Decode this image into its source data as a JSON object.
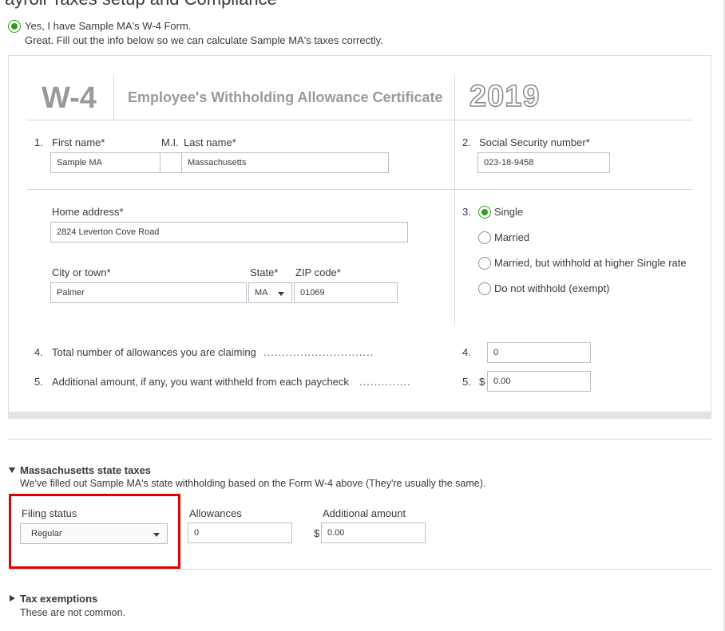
{
  "page": {
    "title": "ayroll Taxes setup and Compliance"
  },
  "confirm": {
    "label": "Yes, I have Sample MA's W-4 Form.",
    "sublabel": "Great. Fill out the info below so we can calculate Sample MA's taxes correctly.",
    "checked": true
  },
  "w4": {
    "form_code": "W-4",
    "title": "Employee's Withholding Allowance Certificate",
    "year": "2019",
    "line1": {
      "num": "1.",
      "first_label": "First name*",
      "mi_label": "M.I.",
      "last_label": "Last name*",
      "first_value": "Sample MA",
      "mi_value": "",
      "last_value": "Massachusetts"
    },
    "line2": {
      "num": "2.",
      "label": "Social Security number*",
      "value": "023-18-9458"
    },
    "address": {
      "label": "Home address*",
      "value": "2824  Leverton Cove Road"
    },
    "city": {
      "label": "City or town*",
      "value": "Palmer"
    },
    "state": {
      "label": "State*",
      "value": "MA"
    },
    "zip": {
      "label": "ZIP code*",
      "value": "01069"
    },
    "line3": {
      "num": "3.",
      "options": [
        {
          "label": "Single",
          "checked": true
        },
        {
          "label": "Married",
          "checked": false
        },
        {
          "label": "Married, but withhold at higher Single rate",
          "checked": false
        },
        {
          "label": "Do not withhold (exempt)",
          "checked": false
        }
      ]
    },
    "line4": {
      "num": "4.",
      "label": "Total number of allowances you are claiming",
      "dots": "..............................",
      "num_right": "4.",
      "value": "0"
    },
    "line5": {
      "num": "5.",
      "label": "Additional amount, if any, you want withheld from each paycheck",
      "dots": "..............",
      "num_right": "5.",
      "currency": "$",
      "value": "0.00"
    }
  },
  "state_taxes": {
    "heading": "Massachusetts state taxes",
    "description": "We've filled out Sample MA's state withholding based on the Form W-4 above (They're usually the same).",
    "filing_status": {
      "label": "Filing status",
      "value": "Regular"
    },
    "allowances": {
      "label": "Allowances",
      "value": "0"
    },
    "additional": {
      "label": "Additional amount",
      "currency": "$",
      "value": "0.00"
    }
  },
  "exemptions": {
    "heading": "Tax exemptions",
    "description": "These are not common."
  },
  "colors": {
    "accent_green": "#2ca01c",
    "highlight_red": "#e00000",
    "text": "#393a3d",
    "muted_title": "#9a9a9a"
  }
}
